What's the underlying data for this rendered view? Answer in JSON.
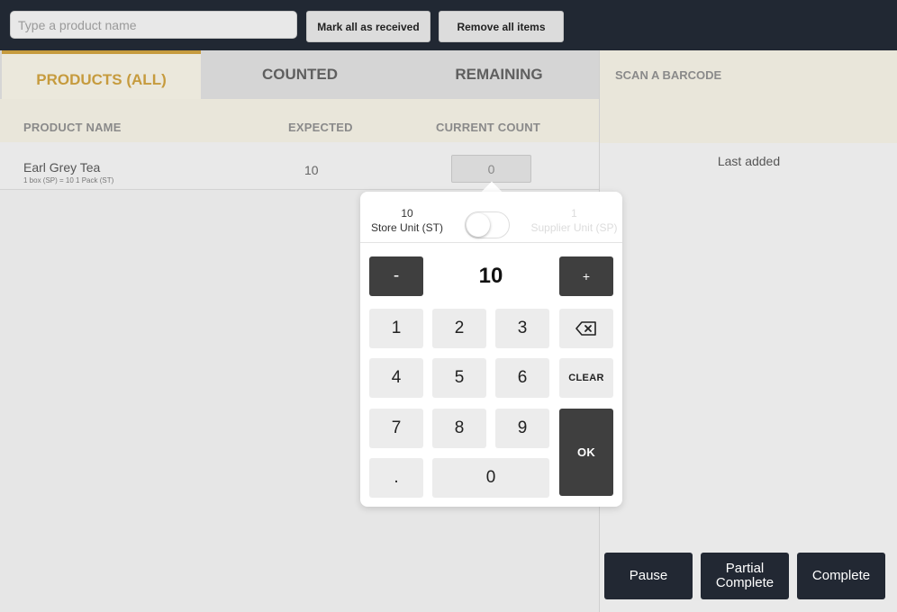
{
  "topbar": {
    "search_placeholder": "Type a product name",
    "mark_all_label": "Mark all as received",
    "remove_all_label": "Remove all items"
  },
  "tabs": [
    {
      "label": "PRODUCTS (ALL)",
      "active": true
    },
    {
      "label": "COUNTED",
      "active": false
    },
    {
      "label": "REMAINING",
      "active": false
    }
  ],
  "table": {
    "columns": [
      "PRODUCT NAME",
      "EXPECTED",
      "CURRENT COUNT"
    ],
    "rows": [
      {
        "name": "Earl Grey Tea",
        "subtitle": "1 box (SP) = 10 1 Pack (ST)",
        "expected": "10",
        "current_count": "0"
      }
    ]
  },
  "right_panel": {
    "scan_label": "SCAN A BARCODE",
    "last_added_label": "Last added",
    "actions": {
      "pause": "Pause",
      "partial_complete": "Partial Complete",
      "complete": "Complete"
    }
  },
  "keypad": {
    "store_unit_value": "10",
    "store_unit_label": "Store Unit (ST)",
    "supplier_unit_value": "1",
    "supplier_unit_label": "Supplier Unit (SP)",
    "minus_label": "-",
    "plus_label": "+",
    "display_value": "10",
    "keys": {
      "k1": "1",
      "k2": "2",
      "k3": "3",
      "k4": "4",
      "k5": "5",
      "k6": "6",
      "k7": "7",
      "k8": "8",
      "k9": "9",
      "dot": ".",
      "k0": "0"
    },
    "clear_label": "CLEAR",
    "ok_label": "OK",
    "backspace_icon": "backspace-icon"
  },
  "colors": {
    "topbar_bg": "#212833",
    "accent_gold": "#c69b3e",
    "dark_button": "#222833",
    "keypad_dark": "#3f3f3f"
  }
}
